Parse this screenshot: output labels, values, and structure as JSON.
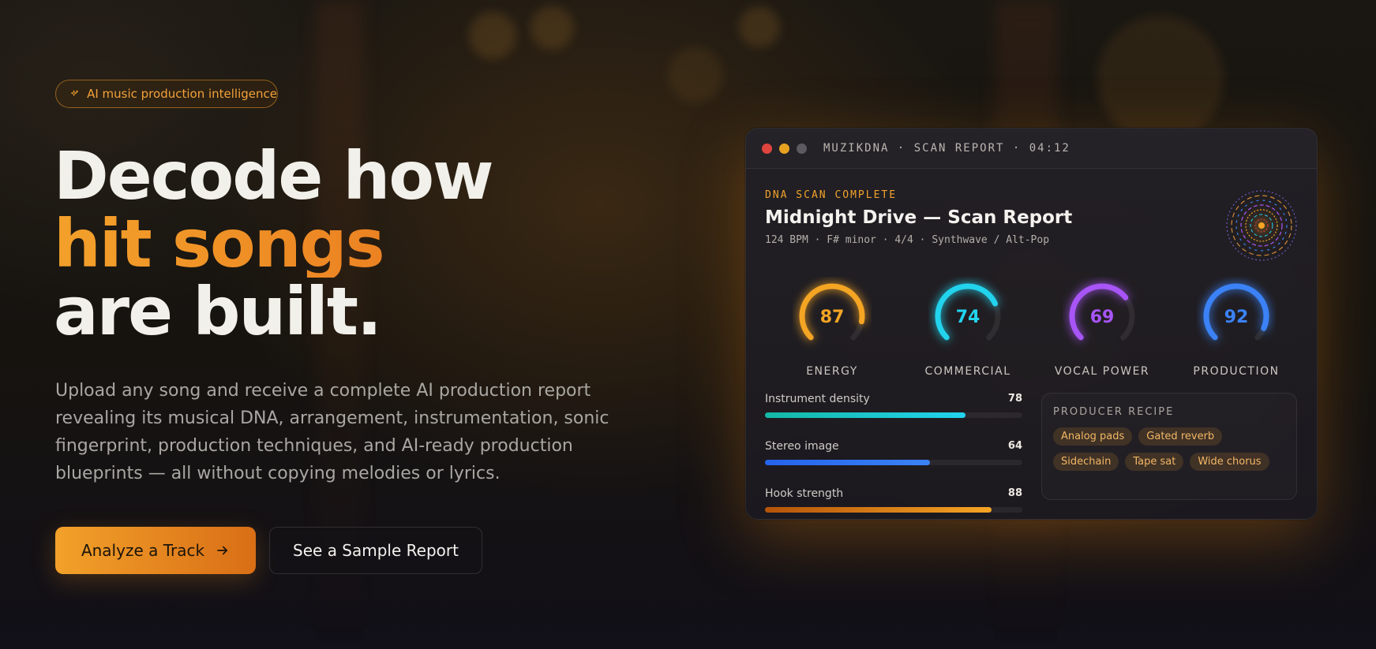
{
  "badge": {
    "label": "AI music production intelligence",
    "icon": "sparkle-icon"
  },
  "hero": {
    "line1": "Decode how",
    "line2": "hit songs",
    "line3": "are built.",
    "subtitle": "Upload any song and receive a complete AI production report revealing its musical DNA, arrangement, instrumentation, sonic fingerprint, production techniques, and AI-ready production blueprints — all without copying melodies or lyrics."
  },
  "actions": {
    "primary_label": "Analyze a Track",
    "primary_icon": "arrow-right-icon",
    "secondary_label": "See a Sample Report"
  },
  "report": {
    "window_title": "MUZIKDNA · SCAN REPORT · 04:12",
    "status": "DNA SCAN COMPLETE",
    "title": "Midnight Drive — Scan Report",
    "meta": "124 BPM · F# minor · 4/4 · Synthwave / Alt-Pop",
    "gauges": [
      {
        "label": "ENERGY",
        "value": 87,
        "color": "#f5a524"
      },
      {
        "label": "COMMERCIAL",
        "value": 74,
        "color": "#22d3ee"
      },
      {
        "label": "VOCAL POWER",
        "value": 69,
        "color": "#a855f7"
      },
      {
        "label": "PRODUCTION",
        "value": 92,
        "color": "#3b82f6"
      }
    ],
    "meters": [
      {
        "label": "Instrument density",
        "value": 78,
        "gradient": [
          "#14b8a6",
          "#22d3ee"
        ]
      },
      {
        "label": "Stereo image",
        "value": 64,
        "gradient": [
          "#2563eb",
          "#3b82f6"
        ]
      },
      {
        "label": "Hook strength",
        "value": 88,
        "gradient": [
          "#b45309",
          "#f5a524"
        ]
      }
    ],
    "recipe": {
      "title": "PRODUCER RECIPE",
      "tags": [
        "Analog pads",
        "Gated reverb",
        "Sidechain",
        "Tape sat",
        "Wide chorus"
      ]
    }
  },
  "colors": {
    "accent": "#f2a12a",
    "accent_dark": "#d96e16",
    "window_dot_red": "#e0443e",
    "window_dot_yellow": "#e8a21f",
    "window_dot_gray": "#5c5a60"
  }
}
